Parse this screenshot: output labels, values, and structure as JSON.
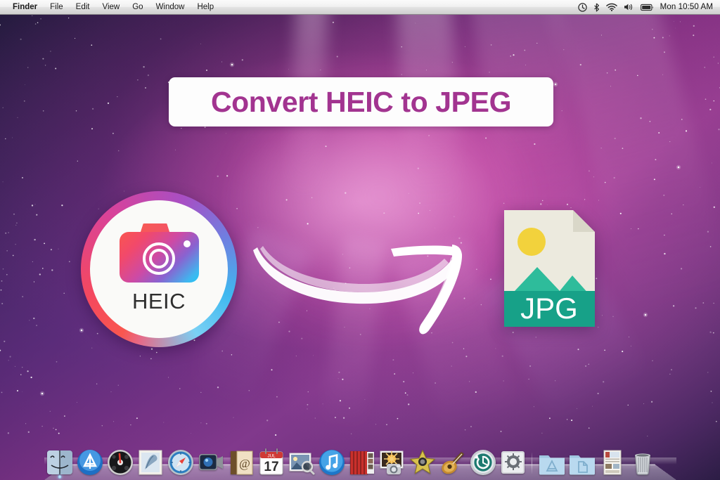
{
  "menubar": {
    "apple_icon": "apple-logo-icon",
    "items": [
      {
        "label": "Finder",
        "bold": true
      },
      {
        "label": "File",
        "bold": false
      },
      {
        "label": "Edit",
        "bold": false
      },
      {
        "label": "View",
        "bold": false
      },
      {
        "label": "Go",
        "bold": false
      },
      {
        "label": "Window",
        "bold": false
      },
      {
        "label": "Help",
        "bold": false
      }
    ],
    "status_icons": [
      {
        "name": "time-machine-icon"
      },
      {
        "name": "bluetooth-icon"
      },
      {
        "name": "wifi-icon"
      },
      {
        "name": "volume-icon"
      },
      {
        "name": "battery-icon"
      }
    ],
    "clock": "Mon 10:50 AM"
  },
  "banner": {
    "title": "Convert HEIC to JPEG",
    "text_color": "#a23490",
    "background_color": "#fdfdfd"
  },
  "source_icon": {
    "name": "heic-camera-icon",
    "label": "HEIC",
    "label_color": "#2e2e2e",
    "ring_colors": [
      "#f9564f",
      "#d8429a",
      "#8a62d0",
      "#22c8f5"
    ],
    "disc_color": "#fafaf8"
  },
  "arrow": {
    "name": "curved-arrow-right-icon",
    "color": "#ffffff",
    "direction": "right"
  },
  "target_icon": {
    "name": "jpg-file-icon",
    "label": "JPG",
    "label_color": "#ffffff",
    "paper_color": "#eceade",
    "fold_color": "#d9d7c8",
    "band_color": "#17a188",
    "mountain_color": "#2ebc9b",
    "sun_color": "#f2d23c"
  },
  "dock": {
    "items": [
      {
        "name": "dock-item-finder",
        "label": "Finder",
        "running": true
      },
      {
        "name": "dock-item-app-store",
        "label": "App Store",
        "running": false
      },
      {
        "name": "dock-item-dashboard",
        "label": "Dashboard",
        "running": false
      },
      {
        "name": "dock-item-mail",
        "label": "Mail",
        "running": false
      },
      {
        "name": "dock-item-safari",
        "label": "Safari",
        "running": false
      },
      {
        "name": "dock-item-facetime",
        "label": "FaceTime",
        "running": false
      },
      {
        "name": "dock-item-address-book",
        "label": "Address Book",
        "running": false
      },
      {
        "name": "dock-item-ical",
        "label": "iCal",
        "running": false
      },
      {
        "name": "dock-item-iphoto-preview",
        "label": "Preview",
        "running": false
      },
      {
        "name": "dock-item-itunes",
        "label": "iTunes",
        "running": false
      },
      {
        "name": "dock-item-photo-booth",
        "label": "Photo Booth",
        "running": false
      },
      {
        "name": "dock-item-iphoto",
        "label": "iPhoto",
        "running": false
      },
      {
        "name": "dock-item-imovie",
        "label": "iMovie",
        "running": false
      },
      {
        "name": "dock-item-garageband",
        "label": "GarageBand",
        "running": false
      },
      {
        "name": "dock-item-time-machine",
        "label": "Time Machine",
        "running": false
      },
      {
        "name": "dock-item-system-preferences",
        "label": "System Preferences",
        "running": false
      }
    ],
    "folders": [
      {
        "name": "dock-item-applications-folder",
        "label": "Applications"
      },
      {
        "name": "dock-item-documents-folder",
        "label": "Documents"
      },
      {
        "name": "dock-item-downloads-stack",
        "label": "Downloads"
      }
    ],
    "trash": {
      "name": "dock-item-trash",
      "label": "Trash"
    },
    "ical_month": "JUL",
    "ical_day": "17"
  }
}
